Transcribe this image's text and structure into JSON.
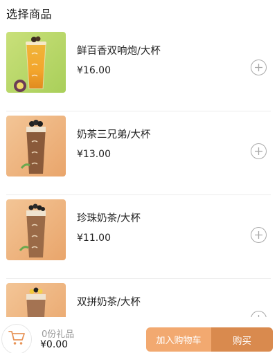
{
  "header": {
    "title": "选择商品"
  },
  "products": [
    {
      "name": "鲜百香双响炮/大杯",
      "price": "¥16.00"
    },
    {
      "name": "奶茶三兄弟/大杯",
      "price": "¥13.00"
    },
    {
      "name": "珍珠奶茶/大杯",
      "price": "¥11.00"
    },
    {
      "name": "双拼奶茶/大杯",
      "price": ""
    }
  ],
  "footer": {
    "gift_count": "0份礼品",
    "total_price": "¥0.00",
    "add_to_cart_label": "加入购物车",
    "buy_label": "购买"
  },
  "icons": {
    "add": "plus-circle-icon",
    "cart": "shopping-cart-icon"
  },
  "colors": {
    "accent_light": "#f2a970",
    "accent_dark": "#d98a4e",
    "cart_icon": "#e8955a"
  }
}
